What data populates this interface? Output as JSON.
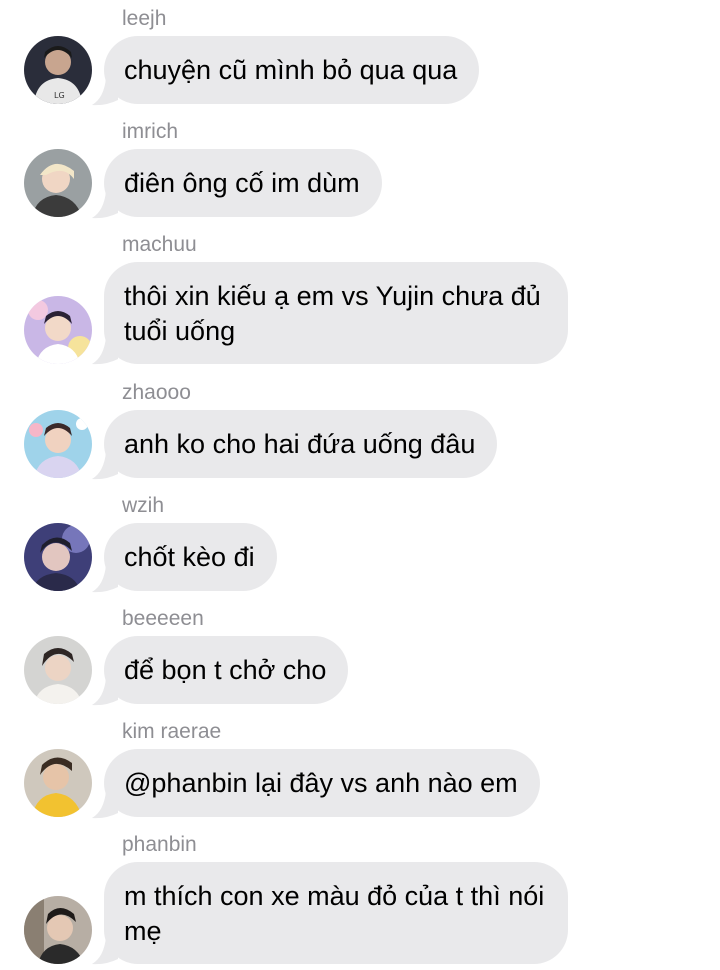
{
  "thread": {
    "bubble_color": "#e9e9eb",
    "sender_color": "#8e8e93",
    "messages": [
      {
        "sender": "leejh",
        "text": "chuyện cũ mình bỏ qua qua",
        "avatar": "avatar-leejh"
      },
      {
        "sender": "imrich",
        "text": "điên ông cố im dùm",
        "avatar": "avatar-imrich"
      },
      {
        "sender": "machuu",
        "text": "thôi xin kiếu ạ em vs Yujin chưa đủ tuổi uống",
        "avatar": "avatar-machuu"
      },
      {
        "sender": "zhaooo",
        "text": "anh ko cho hai đứa uống đâu",
        "avatar": "avatar-zhaooo"
      },
      {
        "sender": "wzih",
        "text": "chốt kèo đi",
        "avatar": "avatar-wzih"
      },
      {
        "sender": "beeeeen",
        "text": "để bọn t chở cho",
        "avatar": "avatar-beeeeen"
      },
      {
        "sender": "kim raerae",
        "text": "@phanbin lại đây vs anh nào em",
        "avatar": "avatar-kim-raerae"
      },
      {
        "sender": "phanbin",
        "text": "m thích con xe màu đỏ của t thì nói mẹ",
        "avatar": "avatar-phanbin"
      }
    ]
  }
}
